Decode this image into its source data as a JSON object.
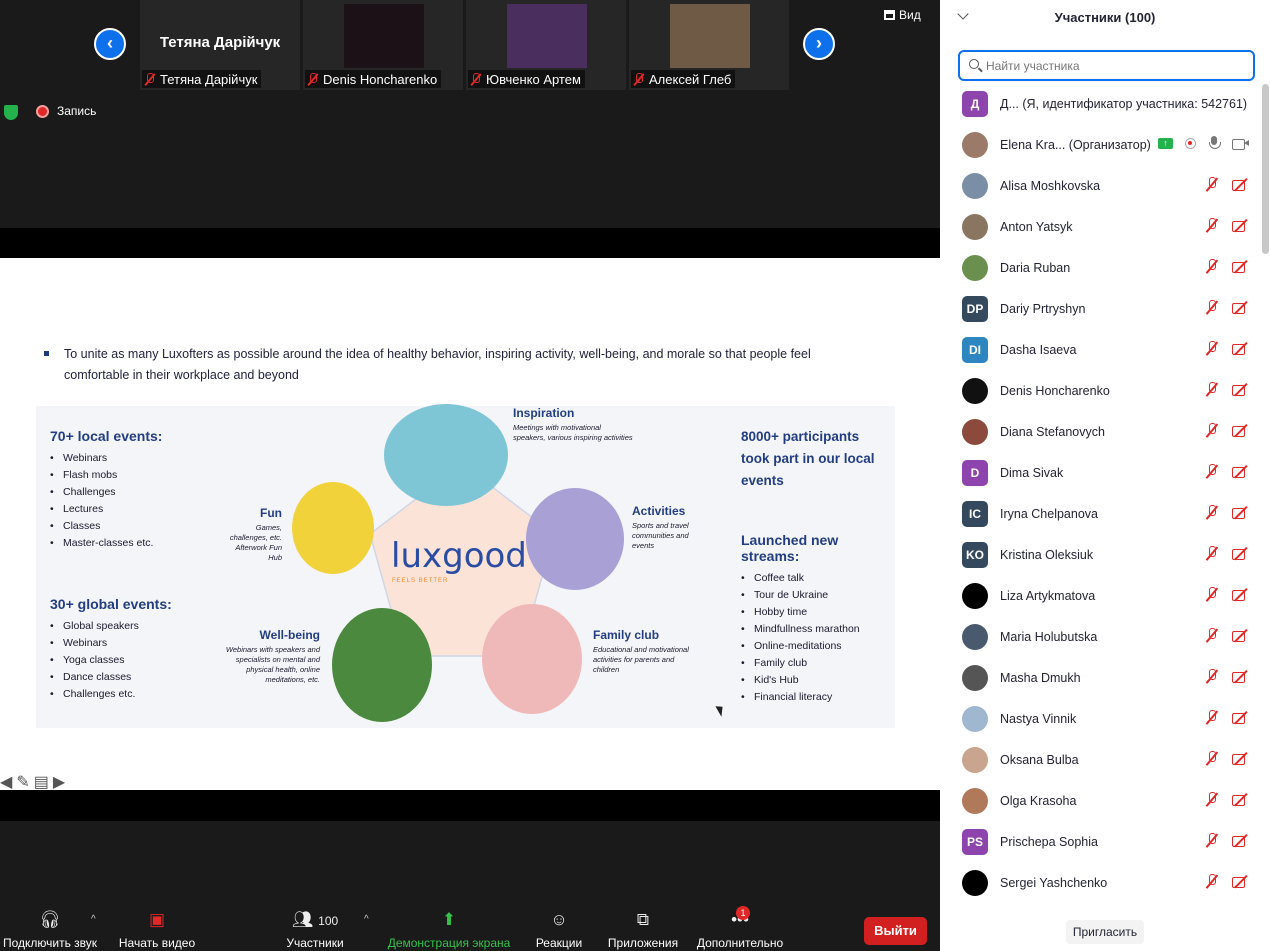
{
  "thumbnails": [
    {
      "display": "Тетяна Дарійчук",
      "name": "Тетяна Дарійчук",
      "video": ""
    },
    {
      "display": "",
      "name": "Denis Honcharenko",
      "video": "#1c1116"
    },
    {
      "display": "",
      "name": "Ювченко Артем",
      "video": "#4a2f5e"
    },
    {
      "display": "",
      "name": "Алексей Глеб",
      "video": "#6e5a45"
    }
  ],
  "nav": {
    "prev": "‹",
    "next": "›"
  },
  "view_label": "Вид",
  "recording_label": "Запись",
  "slide": {
    "bullet": "To unite as many Luxofters as possible around the idea of healthy behavior, inspiring activity, well-being, and morale so that people feel comfortable in their workplace and beyond",
    "local_title": "70+ local events:",
    "local_items": [
      "Webinars",
      "Flash mobs",
      "Challenges",
      "Lectures",
      "Classes",
      "Master-classes etc."
    ],
    "global_title": "30+ global events:",
    "global_items": [
      "Global speakers",
      "Webinars",
      "Yoga classes",
      "Dance classes",
      "Challenges etc."
    ],
    "participants_stat": "8000+ participants took part in our local events",
    "streams_title": "Launched new streams:",
    "streams_items": [
      "Coffee talk",
      "Tour de Ukraine",
      "Hobby time",
      "Mindfullness marathon",
      "Online-meditations",
      "Family club",
      "Kid's Hub",
      "Financial literacy"
    ],
    "logo": "luxgood",
    "logo_sub": "FEELS BETTER",
    "inspiration_title": "Inspiration",
    "inspiration_text": "Meetings with motivational speakers, various inspiring activities",
    "activities_title": "Activities",
    "activities_text": "Sports and travel communities and events",
    "family_title": "Family club",
    "family_text": "Educational and motivational activities for parents and children",
    "wellbeing_title": "Well-being",
    "wellbeing_text": "Webinars with speakers and specialists on mental and physical health, online meditations, etc.",
    "fun_title": "Fun",
    "fun_text": "Games, challenges, etc. Afterwork Fun Hub"
  },
  "toolbar": {
    "audio": "Подключить звук",
    "video": "Начать видео",
    "participants": "Участники",
    "participants_count": "100",
    "share": "Демонстрация экрана",
    "reactions": "Реакции",
    "apps": "Приложения",
    "more": "Дополнительно",
    "more_badge": "1",
    "leave": "Выйти"
  },
  "panel": {
    "title": "Участники (100)",
    "search_placeholder": "Найти участника",
    "invite": "Пригласить"
  },
  "participants": [
    {
      "name": "Д...  (Я, идентификатор участника: 542761)",
      "initials": "Д",
      "color": "#8e44ad",
      "status": "self"
    },
    {
      "name": "Elena Kra... (Организатор)",
      "initials": "",
      "color": "#9c7a6a",
      "status": "host"
    },
    {
      "name": "Alisa Moshkovska",
      "initials": "",
      "color": "#7a8fa6",
      "status": "off"
    },
    {
      "name": "Anton Yatsyk",
      "initials": "",
      "color": "#8a7560",
      "status": "off"
    },
    {
      "name": "Daria Ruban",
      "initials": "",
      "color": "#6b8f4e",
      "status": "off"
    },
    {
      "name": "Dariy Prtryshyn",
      "initials": "DP",
      "color": "#34495e",
      "status": "off"
    },
    {
      "name": "Dasha Isaeva",
      "initials": "DI",
      "color": "#2e86c1",
      "status": "off"
    },
    {
      "name": "Denis Honcharenko",
      "initials": "",
      "color": "#111111",
      "status": "off"
    },
    {
      "name": "Diana Stefanovych",
      "initials": "",
      "color": "#8b4a3c",
      "status": "off"
    },
    {
      "name": "Dima Sivak",
      "initials": "D",
      "color": "#8e44ad",
      "status": "off"
    },
    {
      "name": "Iryna Chelpanova",
      "initials": "IC",
      "color": "#34495e",
      "status": "off"
    },
    {
      "name": "Kristina Oleksiuk",
      "initials": "KO",
      "color": "#34495e",
      "status": "off"
    },
    {
      "name": "Liza Artykmatova",
      "initials": "",
      "color": "#000000",
      "status": "off"
    },
    {
      "name": "Maria Holubutska",
      "initials": "",
      "color": "#4a5a6e",
      "status": "off"
    },
    {
      "name": "Masha Dmukh",
      "initials": "",
      "color": "#555555",
      "status": "off"
    },
    {
      "name": "Nastya Vinnik",
      "initials": "",
      "color": "#9fb7cf",
      "status": "off"
    },
    {
      "name": "Oksana Bulba",
      "initials": "",
      "color": "#c9a48f",
      "status": "off"
    },
    {
      "name": "Olga Krasoha",
      "initials": "",
      "color": "#b07a5a",
      "status": "off"
    },
    {
      "name": "Prischepa Sophia",
      "initials": "PS",
      "color": "#8e44ad",
      "status": "off"
    },
    {
      "name": "Sergei Yashchenko",
      "initials": "",
      "color": "#000000",
      "status": "off"
    }
  ]
}
